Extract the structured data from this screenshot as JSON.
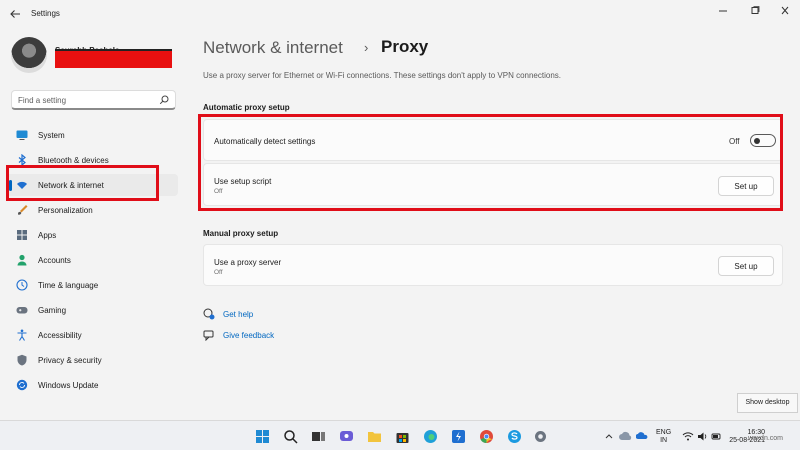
{
  "window": {
    "title": "Settings"
  },
  "user": {
    "name": "Saurabh Pachala"
  },
  "search": {
    "placeholder": "Find a setting"
  },
  "sidebar": {
    "items": [
      {
        "label": "System",
        "icon": "monitor-icon"
      },
      {
        "label": "Bluetooth & devices",
        "icon": "bluetooth-icon"
      },
      {
        "label": "Network & internet",
        "icon": "wifi-icon",
        "active": true
      },
      {
        "label": "Personalization",
        "icon": "brush-icon"
      },
      {
        "label": "Apps",
        "icon": "apps-icon"
      },
      {
        "label": "Accounts",
        "icon": "person-icon"
      },
      {
        "label": "Time & language",
        "icon": "globe-clock-icon"
      },
      {
        "label": "Gaming",
        "icon": "gamepad-icon"
      },
      {
        "label": "Accessibility",
        "icon": "accessibility-icon"
      },
      {
        "label": "Privacy & security",
        "icon": "shield-icon"
      },
      {
        "label": "Windows Update",
        "icon": "update-icon"
      }
    ]
  },
  "header": {
    "parent": "Network & internet",
    "separator": "›",
    "title": "Proxy"
  },
  "description": "Use a proxy server for Ethernet or Wi-Fi connections. These settings don't apply to VPN connections.",
  "automatic": {
    "section_title": "Automatic proxy setup",
    "detect_label": "Automatically detect settings",
    "detect_state": "Off",
    "script_label": "Use setup script",
    "script_state": "Off",
    "script_button": "Set up"
  },
  "manual": {
    "section_title": "Manual proxy setup",
    "server_label": "Use a proxy server",
    "server_state": "Off",
    "server_button": "Set up"
  },
  "help": {
    "get_help": "Get help",
    "give_feedback": "Give feedback"
  },
  "taskbar": {
    "language": "ENG",
    "region": "IN",
    "time": "16:30",
    "date": "25-08-2021",
    "show_desktop": "Show desktop"
  },
  "watermark": "wsxdn.com",
  "colors": {
    "accent": "#0067c0",
    "highlight_red": "#e00d18"
  }
}
